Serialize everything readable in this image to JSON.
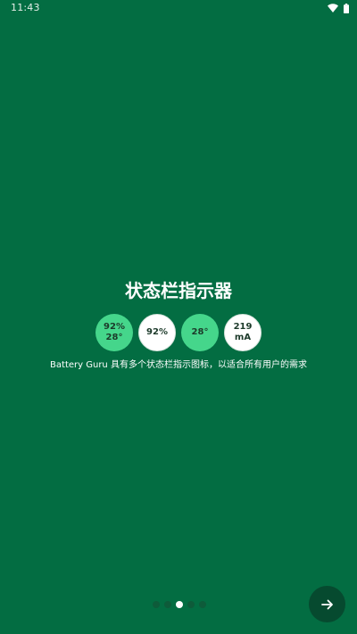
{
  "status_bar": {
    "time": "11:43",
    "icons": [
      "wifi-icon",
      "battery-icon"
    ]
  },
  "onboarding": {
    "title": "状态栏指示器",
    "description": "Battery Guru 具有多个状态栏指示图标，以适合所有用户的需求",
    "indicators": [
      {
        "line1": "92%",
        "line2": "28°",
        "style": "green"
      },
      {
        "line1": "92%",
        "line2": "",
        "style": "white"
      },
      {
        "line1": "28°",
        "line2": "",
        "style": "green"
      },
      {
        "line1": "219",
        "line2": "mA",
        "style": "white"
      }
    ]
  },
  "pager": {
    "total_pages": 5,
    "current_page": 3
  },
  "next_button": {
    "icon": "arrow-right-icon"
  },
  "colors": {
    "background": "#036d42",
    "indicator_green": "#45d68b",
    "indicator_white": "#ffffff",
    "next_button": "#064a2f"
  }
}
